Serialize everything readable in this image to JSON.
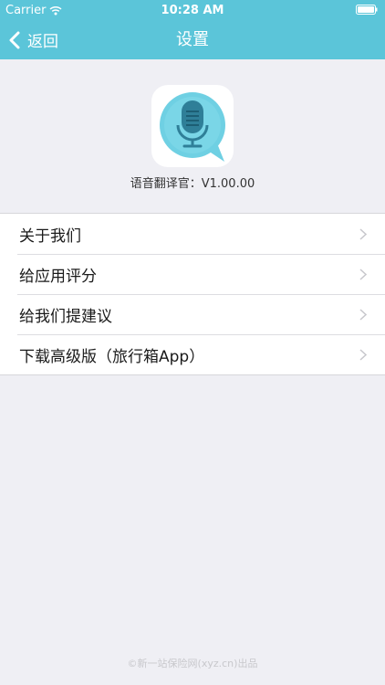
{
  "status_bar": {
    "carrier": "Carrier",
    "time": "10:28 AM"
  },
  "nav": {
    "back_label": "返回",
    "title": "设置"
  },
  "app": {
    "icon": "microphone-app-icon",
    "version_text": "语音翻译官：V1.00.00"
  },
  "menu": {
    "items": [
      {
        "label": "关于我们"
      },
      {
        "label": "给应用评分"
      },
      {
        "label": "给我们提建议"
      },
      {
        "label": "下载高级版（旅行箱App）"
      }
    ]
  },
  "footer": {
    "text": "©新一站保险网(xyz.cn)出品"
  },
  "colors": {
    "header": "#5bc5d9",
    "background": "#efeff4",
    "icon_bubble": "#6fd0e3"
  }
}
